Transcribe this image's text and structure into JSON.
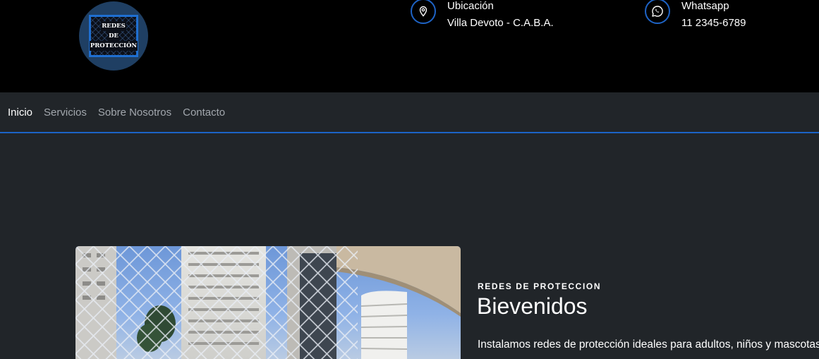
{
  "header": {
    "logo_text": [
      "REDES",
      "DE",
      "PROTECCIÓN"
    ],
    "contacts": [
      {
        "label": "Ubicación",
        "value": "Villa Devoto - C.A.B.A.",
        "icon": "location-pin-icon"
      },
      {
        "label": "Whatsapp",
        "value": "11 2345-6789",
        "icon": "whatsapp-icon"
      }
    ]
  },
  "nav": {
    "items": [
      {
        "label": "Inicio",
        "active": true
      },
      {
        "label": "Servicios",
        "active": false
      },
      {
        "label": "Sobre Nosotros",
        "active": false
      },
      {
        "label": "Contacto",
        "active": false
      }
    ]
  },
  "hero": {
    "eyebrow": "REDES DE PROTECCION",
    "title": "Bievenidos",
    "lead": "Instalamos redes de protección ideales para adultos, niños y mascotas"
  },
  "colors": {
    "accent": "#1c64c6",
    "topbar_bg": "#000000",
    "page_bg": "#212529"
  }
}
